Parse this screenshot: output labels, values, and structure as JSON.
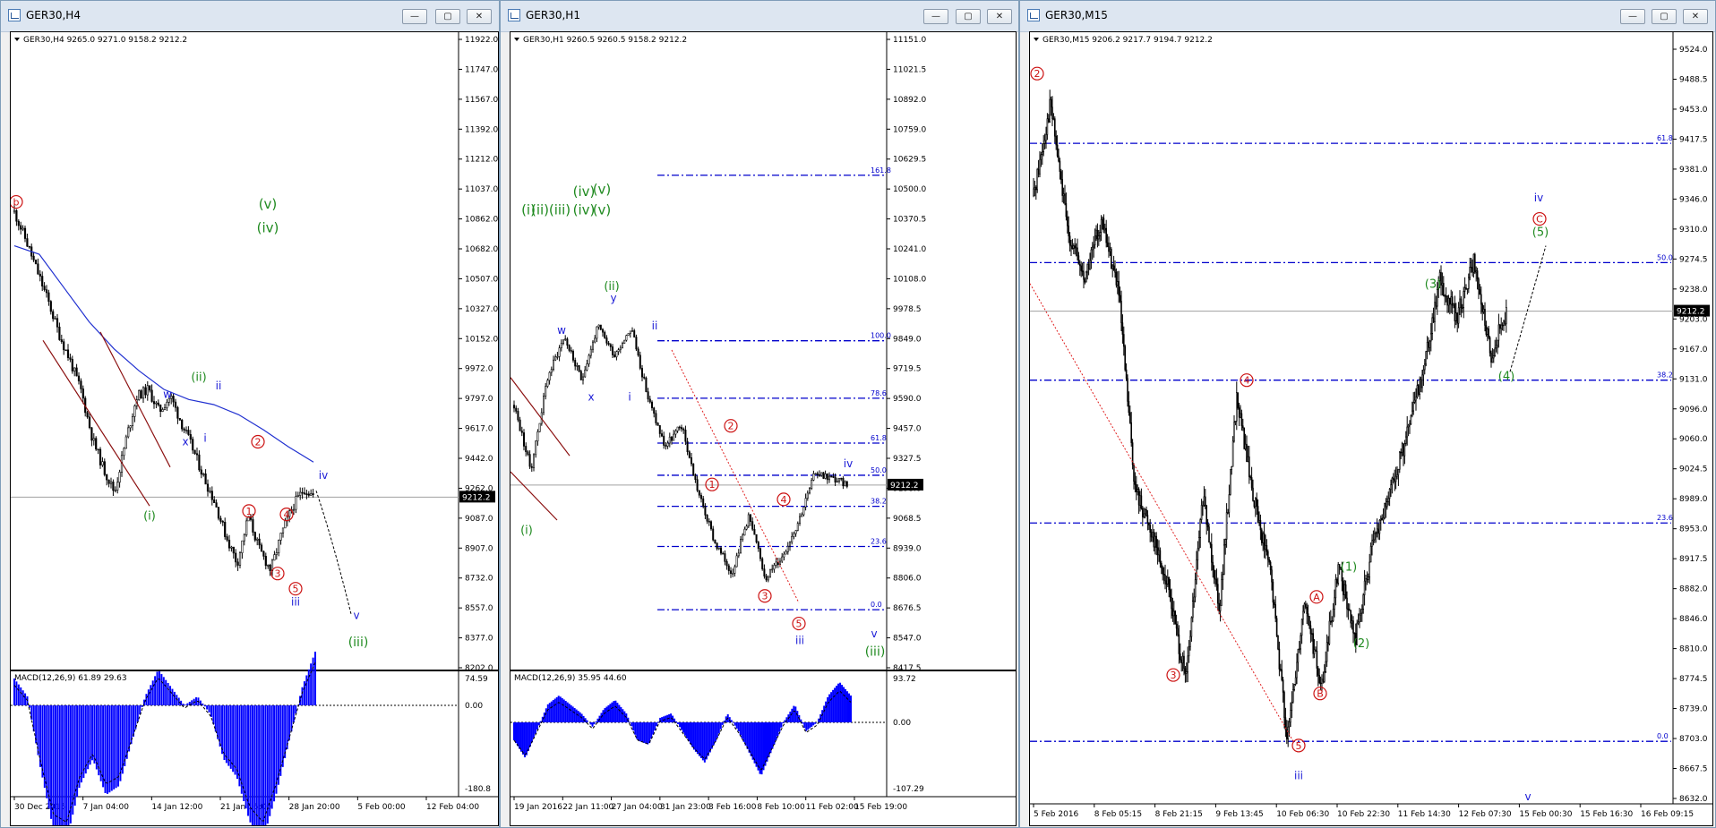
{
  "windows": [
    {
      "id": "h4",
      "title": "GER30,H4",
      "header": "GER30,H4  9265.0 9271.0 9158.2 9212.2",
      "price_badge": "9212.2",
      "price_ticks": [
        "11922.0",
        "11747.0",
        "11567.0",
        "11392.0",
        "11212.0",
        "11037.0",
        "10862.0",
        "10682.0",
        "10507.0",
        "10327.0",
        "10152.0",
        "9972.0",
        "9797.0",
        "9617.0",
        "9442.0",
        "9262.0",
        "9087.0",
        "8907.0",
        "8732.0",
        "8557.0",
        "8377.0",
        "8202.0"
      ],
      "time_ticks": [
        "30 Dec 2015",
        "7 Jan 04:00",
        "14 Jan 12:00",
        "21 Jan 16:00",
        "28 Jan 20:00",
        "5 Feb 00:00",
        "12 Feb 04:00"
      ],
      "macd": {
        "label": "MACD(12,26,9) 61.89 29.63",
        "ticks": [
          "74.59",
          "0.00",
          "-180.8"
        ]
      },
      "wave_labels": {
        "b": "b",
        "v_top": "(v)",
        "iv_top": "(iv)",
        "i_green": "(i)",
        "ii_green": "(ii)",
        "w": "w",
        "x": "x",
        "i_blue": "i",
        "ii_blue": "ii",
        "c1": "1",
        "c2": "2",
        "c3": "3",
        "c4": "4",
        "c5": "5",
        "iii_blue": "iii",
        "iv_blue": "iv",
        "v_blue": "v",
        "iii_green": "(iii)"
      }
    },
    {
      "id": "h1",
      "title": "GER30,H1",
      "header": "GER30,H1  9260.5 9260.5 9158.2 9212.2",
      "price_badge": "9212.2",
      "price_ticks": [
        "11151.0",
        "11021.5",
        "10892.0",
        "10759.0",
        "10629.5",
        "10500.0",
        "10370.5",
        "10241.0",
        "10108.0",
        "9978.5",
        "9849.0",
        "9719.5",
        "9590.0",
        "9457.0",
        "9327.5",
        "9198.0",
        "9068.5",
        "8939.0",
        "8806.0",
        "8676.5",
        "8547.0",
        "8417.5"
      ],
      "time_ticks": [
        "19 Jan 2016",
        "22 Jan 11:00",
        "27 Jan 04:00",
        "31 Jan 23:00",
        "3 Feb 16:00",
        "8 Feb 10:00",
        "11 Feb 02:00",
        "15 Feb 19:00"
      ],
      "fib_labels": [
        "161.8",
        "100.0",
        "78.6",
        "61.8",
        "50.0",
        "38.2",
        "23.6",
        "0.0"
      ],
      "macd": {
        "label": "MACD(12,26,9) 35.95 44.60",
        "ticks": [
          "93.72",
          "0.00",
          "-107.29"
        ]
      },
      "wave_labels": {
        "i_top": "(i)",
        "ii_top": "(ii)",
        "iii_top": "(iii)",
        "iv_top1": "(iv)",
        "v_top1": "(v)",
        "iv_top2": "(iv)",
        "v_top2": "(v)",
        "w": "w",
        "x": "x",
        "y": "y",
        "ii_green": "(ii)",
        "i_blue": "i",
        "ii_blue": "ii",
        "i_green": "(i)",
        "c1": "1",
        "c2": "2",
        "c3": "3",
        "c4": "4",
        "c5": "5",
        "iii_blue": "iii",
        "iv_blue": "iv",
        "v_blue": "v",
        "iii_green": "(iii)"
      }
    },
    {
      "id": "m15",
      "title": "GER30,M15",
      "header": "GER30,M15  9206.2 9217.7 9194.7 9212.2",
      "price_badge": "9212.2",
      "price_ticks": [
        "9524.0",
        "9488.5",
        "9453.0",
        "9417.5",
        "9381.0",
        "9346.0",
        "9310.0",
        "9274.5",
        "9238.0",
        "9203.0",
        "9167.0",
        "9131.0",
        "9096.0",
        "9060.0",
        "9024.5",
        "8989.0",
        "8953.0",
        "8917.5",
        "8882.0",
        "8846.0",
        "8810.0",
        "8774.5",
        "8739.0",
        "8703.0",
        "8667.5",
        "8632.0"
      ],
      "time_ticks": [
        "5 Feb 2016",
        "8 Feb 05:15",
        "8 Feb 21:15",
        "9 Feb 13:45",
        "10 Feb 06:30",
        "10 Feb 22:30",
        "11 Feb 14:30",
        "12 Feb 07:30",
        "15 Feb 00:30",
        "15 Feb 16:30",
        "16 Feb 09:15"
      ],
      "fib_labels": [
        "61.8",
        "50.0",
        "38.2",
        "23.6",
        "0.0"
      ],
      "wave_labels": {
        "c2": "2",
        "c4": "4",
        "c3": "3",
        "c5": "5",
        "iii_blue": "iii",
        "A": "A",
        "B": "B",
        "C": "C",
        "w1": "(1)",
        "w2": "(2)",
        "w3": "(3)",
        "w4": "(4)",
        "w5": "(5)",
        "iv_blue": "iv",
        "v_blue": "v"
      }
    }
  ],
  "colors": {
    "green": "#1f8a1f",
    "red": "#cc1111",
    "blue": "#1a1ad6",
    "fib": "#0000cc",
    "ma": "#2030d0",
    "macd": "#0000ff"
  },
  "chart_data": [
    {
      "type": "candlestick",
      "symbol": "GER30",
      "timeframe": "H4",
      "ohlc_last": {
        "open": 9265.0,
        "high": 9271.0,
        "low": 9158.2,
        "close": 9212.2
      },
      "ylim": [
        8202.0,
        11922.0
      ],
      "x_labels": [
        "30 Dec 2015",
        "7 Jan 04:00",
        "14 Jan 12:00",
        "21 Jan 16:00",
        "28 Jan 20:00",
        "5 Feb 00:00",
        "12 Feb 04:00"
      ],
      "close_path": [
        10900,
        10740,
        10560,
        10380,
        10180,
        10020,
        9840,
        9560,
        9380,
        9240,
        9550,
        9810,
        9850,
        9720,
        9810,
        9650,
        9500,
        9330,
        9180,
        8980,
        8820,
        9100,
        8900,
        8780,
        9000,
        9160,
        9262,
        9212
      ],
      "ma_path": [
        10700,
        10650,
        10450,
        10250,
        10090,
        9960,
        9850,
        9790,
        9760,
        9700,
        9610,
        9510,
        9420
      ],
      "macd": {
        "macd": 61.89,
        "signal": 29.63,
        "ylim": [
          -180.8,
          74.59
        ]
      }
    },
    {
      "type": "candlestick",
      "symbol": "GER30",
      "timeframe": "H1",
      "ohlc_last": {
        "open": 9260.5,
        "high": 9260.5,
        "low": 9158.2,
        "close": 9212.2
      },
      "ylim": [
        8417.5,
        11151.0
      ],
      "x_labels": [
        "19 Jan 2016",
        "22 Jan 11:00",
        "27 Jan 04:00",
        "31 Jan 23:00",
        "3 Feb 16:00",
        "8 Feb 10:00",
        "11 Feb 02:00",
        "15 Feb 19:00"
      ],
      "close_path": [
        9560,
        9280,
        9680,
        9860,
        9670,
        9900,
        9780,
        9900,
        9590,
        9380,
        9470,
        9180,
        8960,
        8830,
        9080,
        8810,
        8900,
        9060,
        9270,
        9240,
        9212
      ],
      "fibonacci": [
        {
          "level": "161.8",
          "price": 10560
        },
        {
          "level": "100.0",
          "price": 9840
        },
        {
          "level": "78.6",
          "price": 9590
        },
        {
          "level": "61.8",
          "price": 9395
        },
        {
          "level": "50.0",
          "price": 9255
        },
        {
          "level": "38.2",
          "price": 9120
        },
        {
          "level": "23.6",
          "price": 8945
        },
        {
          "level": "0.0",
          "price": 8670
        }
      ],
      "macd": {
        "macd": 35.95,
        "signal": 44.6,
        "ylim": [
          -107.29,
          93.72
        ]
      }
    },
    {
      "type": "candlestick",
      "symbol": "GER30",
      "timeframe": "M15",
      "ohlc_last": {
        "open": 9206.2,
        "high": 9217.7,
        "low": 9194.7,
        "close": 9212.2
      },
      "ylim": [
        8632.0,
        9524.0
      ],
      "x_labels": [
        "5 Feb 2016",
        "8 Feb 05:15",
        "8 Feb 21:15",
        "9 Feb 13:45",
        "10 Feb 06:30",
        "10 Feb 22:30",
        "11 Feb 14:30",
        "12 Feb 07:30",
        "15 Feb 00:30",
        "15 Feb 16:30",
        "16 Feb 09:15"
      ],
      "close_path": [
        9350,
        9460,
        9310,
        9250,
        9320,
        9240,
        9000,
        8950,
        8880,
        8770,
        8990,
        8860,
        9110,
        8990,
        8900,
        8700,
        8870,
        8760,
        8910,
        8820,
        8930,
        8990,
        9060,
        9140,
        9250,
        9205,
        9270,
        9160,
        9212
      ],
      "fibonacci": [
        {
          "level": "61.8",
          "price": 9412
        },
        {
          "level": "50.0",
          "price": 9270
        },
        {
          "level": "38.2",
          "price": 9130
        },
        {
          "level": "23.6",
          "price": 8960
        },
        {
          "level": "0.0",
          "price": 8700
        }
      ]
    }
  ]
}
